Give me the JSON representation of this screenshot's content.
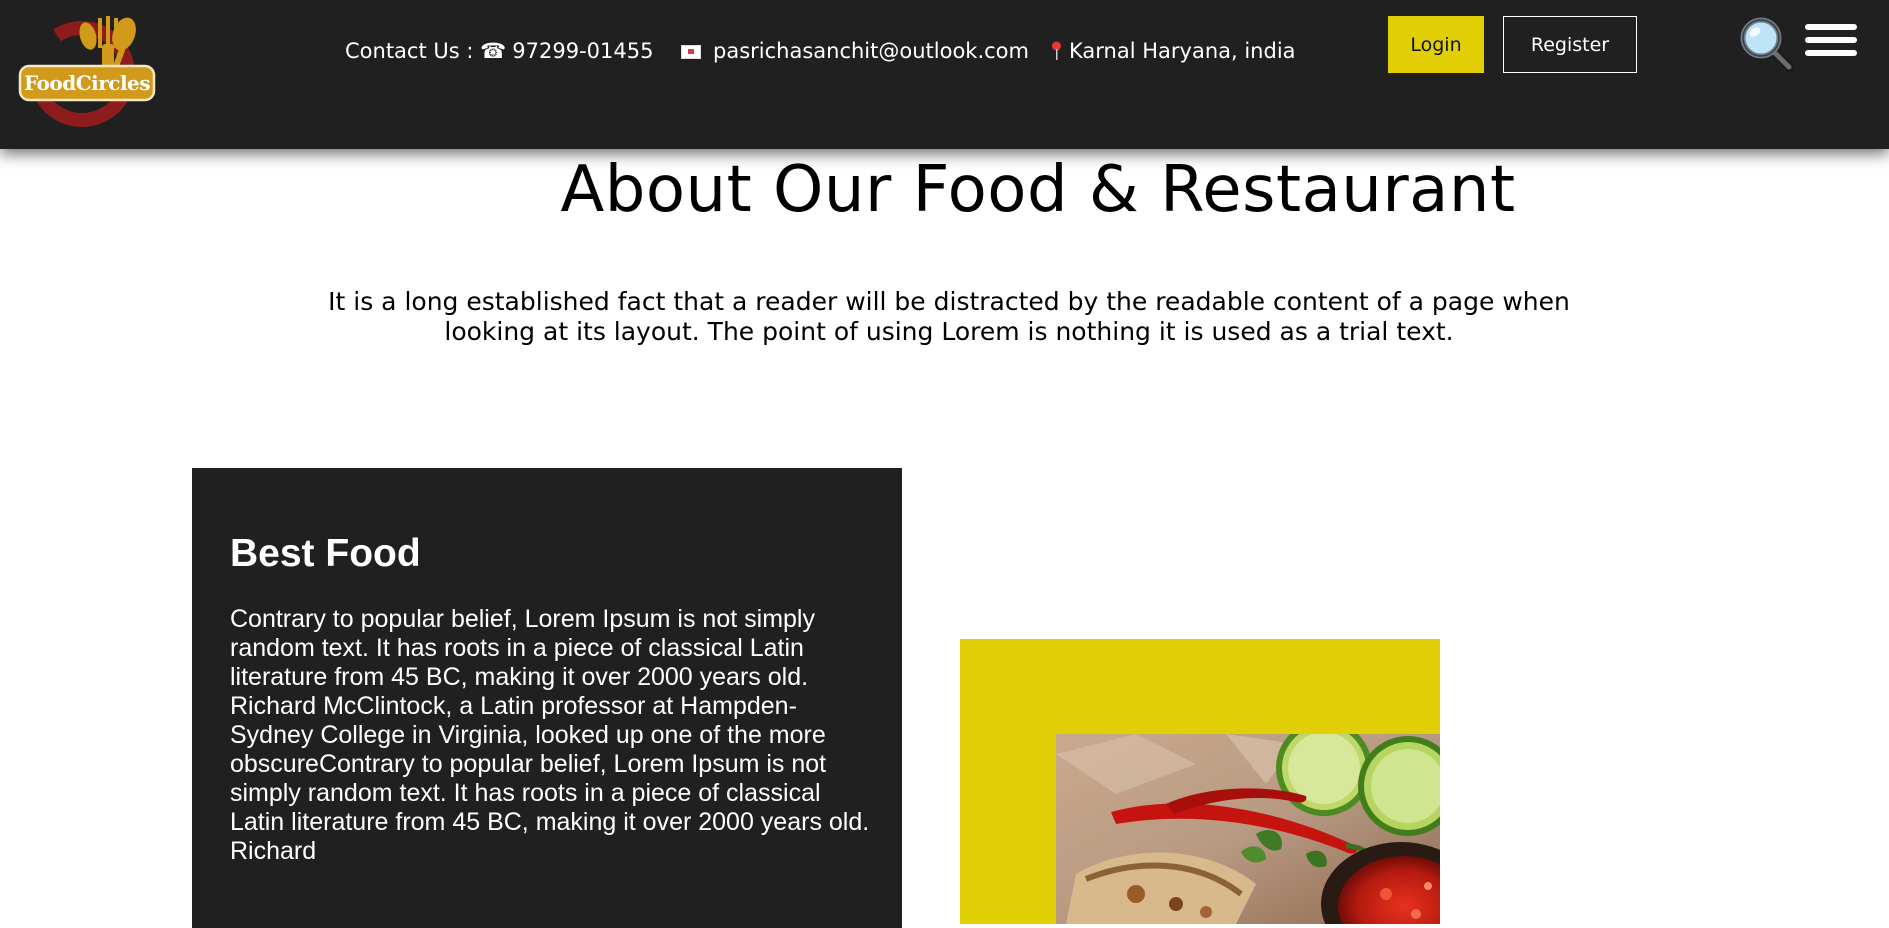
{
  "brand": {
    "name": "FoodCircles",
    "colors": {
      "accent": "#e2cf06",
      "header_bg": "#202020",
      "logo_red": "#8e1c1c",
      "logo_gold": "#d19a1a"
    }
  },
  "header": {
    "contact_label": "Contact Us : ",
    "phone": "97299-01455",
    "email": "pasrichasanchit@outlook.com",
    "location": "Karnal Haryana, india",
    "icons": {
      "phone": "telephone-icon",
      "email": "envelope-icon",
      "location": "map-pin-icon",
      "search": "search-icon",
      "menu": "hamburger-menu-icon"
    },
    "login_label": "Login",
    "register_label": "Register"
  },
  "about": {
    "title": "About Our Food & Restaurant",
    "description": "It is a long established fact that a reader will be distracted by the readable content of a page when looking at its layout. The point of using Lorem is nothing it is used as a trial text."
  },
  "best_food": {
    "title": "Best Food",
    "body": "Contrary to popular belief, Lorem Ipsum is not simply random text. It has roots in a piece of classical Latin literature from 45 BC, making it over 2000 years old. Richard McClintock, a Latin professor at Hampden-Sydney College in Virginia, looked up one of the more obscureContrary to popular belief, Lorem Ipsum is not simply random text. It has roots in a piece of classical Latin literature from 45 BC, making it over 2000 years old. Richard"
  }
}
